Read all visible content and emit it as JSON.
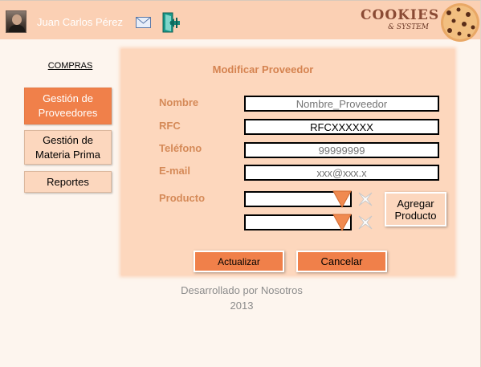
{
  "header": {
    "user_name": "Juan Carlos Pérez",
    "logo_title": "COOKIES",
    "logo_subtitle": "& SYSTEM",
    "icons": [
      "avatar",
      "mail-icon",
      "exit-icon",
      "cookie-icon"
    ]
  },
  "sidebar": {
    "section_title": "COMPRAS",
    "items": [
      {
        "label": "Gestión de Proveedores",
        "active": true
      },
      {
        "label": "Gestión de Materia Prima",
        "active": false
      },
      {
        "label": "Reportes",
        "active": false
      }
    ]
  },
  "form": {
    "title": "Modificar Proveedor",
    "fields": {
      "nombre": {
        "label": "Nombre",
        "placeholder": "Nombre_Proveedor",
        "value": ""
      },
      "rfc": {
        "label": "RFC",
        "placeholder": "",
        "value": "RFCXXXXXX"
      },
      "telefono": {
        "label": "Teléfono",
        "placeholder": "99999999",
        "value": ""
      },
      "email": {
        "label": "E-mail",
        "placeholder": "xxx@xxx.x",
        "value": ""
      }
    },
    "producto_label": "Producto",
    "product_selects": [
      "",
      ""
    ],
    "add_product_label": "Agregar Producto",
    "update_label": "Actualizar",
    "cancel_label": "Cancelar"
  },
  "footer": {
    "credit": "Desarrollado por Nosotros",
    "year": "2013"
  },
  "colors": {
    "accent": "#f0804a",
    "panel": "#fdd7bd",
    "header": "#fbd0b4",
    "label": "#d58a58"
  }
}
